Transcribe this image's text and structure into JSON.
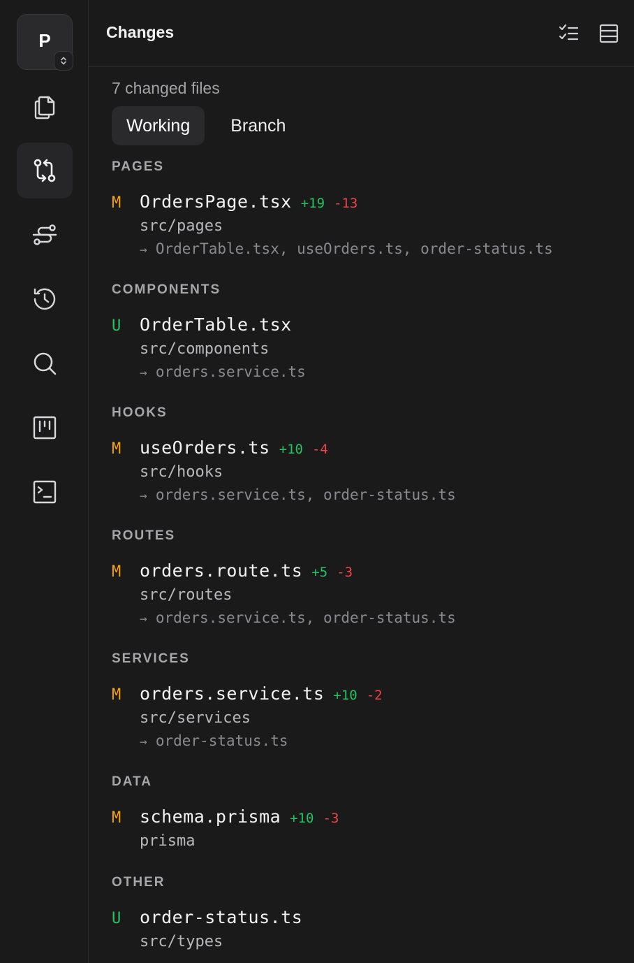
{
  "project": {
    "letter": "P",
    "switch_icon": "chevron-up-down-icon"
  },
  "rail": {
    "items": [
      {
        "name": "files",
        "icon": "files-icon",
        "active": false
      },
      {
        "name": "changes",
        "icon": "git-compare-icon",
        "active": true
      },
      {
        "name": "flow",
        "icon": "route-icon",
        "active": false
      },
      {
        "name": "history",
        "icon": "history-icon",
        "active": false
      },
      {
        "name": "search",
        "icon": "search-icon",
        "active": false
      },
      {
        "name": "board",
        "icon": "kanban-icon",
        "active": false
      },
      {
        "name": "terminal",
        "icon": "terminal-icon",
        "active": false
      }
    ]
  },
  "header": {
    "title": "Changes",
    "actions": [
      "checklist-icon",
      "layout-rows-icon"
    ]
  },
  "summary": {
    "count_label": "7 changed files"
  },
  "tabs": [
    {
      "label": "Working",
      "active": true
    },
    {
      "label": "Branch",
      "active": false
    }
  ],
  "groups": [
    {
      "title": "PAGES",
      "files": [
        {
          "status": "M",
          "name": "OrdersPage.tsx",
          "add": "+19",
          "del": "-13",
          "path": "src/pages",
          "deps": "OrderTable.tsx, useOrders.ts, order-status.ts"
        }
      ]
    },
    {
      "title": "COMPONENTS",
      "files": [
        {
          "status": "U",
          "name": "OrderTable.tsx",
          "add": "",
          "del": "",
          "path": "src/components",
          "deps": "orders.service.ts"
        }
      ]
    },
    {
      "title": "HOOKS",
      "files": [
        {
          "status": "M",
          "name": "useOrders.ts",
          "add": "+10",
          "del": "-4",
          "path": "src/hooks",
          "deps": "orders.service.ts, order-status.ts"
        }
      ]
    },
    {
      "title": "ROUTES",
      "files": [
        {
          "status": "M",
          "name": "orders.route.ts",
          "add": "+5",
          "del": "-3",
          "path": "src/routes",
          "deps": "orders.service.ts, order-status.ts"
        }
      ]
    },
    {
      "title": "SERVICES",
      "files": [
        {
          "status": "M",
          "name": "orders.service.ts",
          "add": "+10",
          "del": "-2",
          "path": "src/services",
          "deps": "order-status.ts"
        }
      ]
    },
    {
      "title": "DATA",
      "files": [
        {
          "status": "M",
          "name": "schema.prisma",
          "add": "+10",
          "del": "-3",
          "path": "prisma",
          "deps": ""
        }
      ]
    },
    {
      "title": "OTHER",
      "files": [
        {
          "status": "U",
          "name": "order-status.ts",
          "add": "",
          "del": "",
          "path": "src/types",
          "deps": ""
        }
      ]
    }
  ],
  "colors": {
    "modified": "#f59e0b",
    "untracked": "#22c55e",
    "additions": "#22c55e",
    "deletions": "#ef4444"
  }
}
